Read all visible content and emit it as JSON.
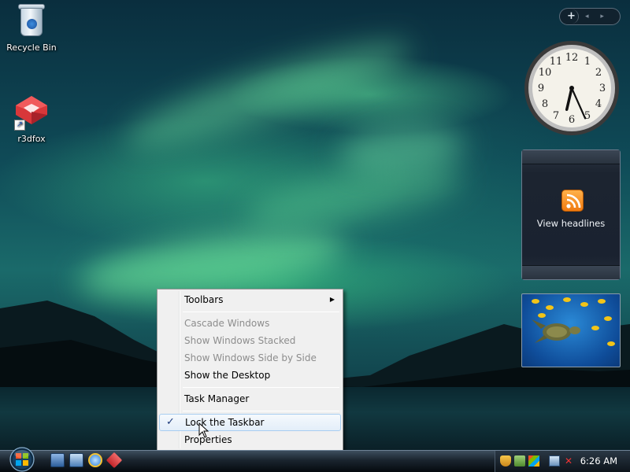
{
  "desktop": {
    "icons": [
      {
        "label": "Recycle Bin",
        "icon": "recycle-bin-icon"
      },
      {
        "label": "r3dfox",
        "icon": "r3dfox-icon"
      }
    ]
  },
  "sidebar": {
    "add_button": "+",
    "nav_arrows": "◂ ▸",
    "clock": {
      "time": "6:26",
      "hour": 6,
      "minute": 26
    },
    "feed_gadget": {
      "text": "View headlines",
      "icon": "rss-icon"
    },
    "slideshow": {
      "subject": "sea turtle with yellow fish"
    }
  },
  "context_menu": {
    "items": [
      {
        "label": "Toolbars",
        "has_submenu": true,
        "disabled": false
      },
      {
        "separator": true
      },
      {
        "label": "Cascade Windows",
        "disabled": true
      },
      {
        "label": "Show Windows Stacked",
        "disabled": true
      },
      {
        "label": "Show Windows Side by Side",
        "disabled": true
      },
      {
        "label": "Show the Desktop",
        "disabled": false
      },
      {
        "separator": true
      },
      {
        "label": "Task Manager",
        "disabled": false
      },
      {
        "separator": true
      },
      {
        "label": "Lock the Taskbar",
        "checked": true,
        "highlighted": true
      },
      {
        "label": "Properties",
        "disabled": false
      }
    ],
    "check_glyph": "✓",
    "submenu_glyph": "▶"
  },
  "taskbar": {
    "quick_launch": [
      "show-desktop-icon",
      "switch-windows-icon",
      "internet-explorer-icon",
      "r3dfox-icon"
    ],
    "tray_icons": [
      "security-shield-icon",
      "network-warning-icon",
      "windows-flag-icon",
      "network-icon",
      "volume-muted-icon"
    ],
    "time": "6:26 AM"
  },
  "colors": {
    "menu_bg": "#f0f0f0",
    "menu_highlight_border": "#a8cdf0",
    "disabled_text": "#8d8d8d",
    "rss_orange": "#f07a10"
  }
}
